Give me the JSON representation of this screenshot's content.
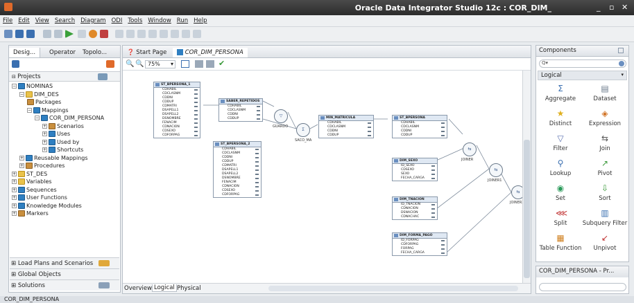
{
  "app": {
    "title": "Oracle Data Integrator Studio 12c : COR_DIM_",
    "minimize": "_",
    "maximize": "▫",
    "close": "✕"
  },
  "menu": [
    "File",
    "Edit",
    "View",
    "Search",
    "Diagram",
    "ODI",
    "Tools",
    "Window",
    "Run",
    "Help"
  ],
  "left": {
    "tabs": [
      "Desig...",
      "Operator",
      "Topolo..."
    ],
    "section": "Projects",
    "tree": [
      {
        "label": "NOMINAS",
        "depth": 0,
        "exp": "−",
        "icon": "project"
      },
      {
        "label": "DIM_DES",
        "depth": 1,
        "exp": "−",
        "icon": "folder"
      },
      {
        "label": "Packages",
        "depth": 2,
        "exp": "",
        "icon": "package"
      },
      {
        "label": "Mappings",
        "depth": 2,
        "exp": "−",
        "icon": "map"
      },
      {
        "label": "COR_DIM_PERSONA",
        "depth": 3,
        "exp": "−",
        "icon": "map"
      },
      {
        "label": "Scenarios",
        "depth": 4,
        "exp": "+",
        "icon": "scenario"
      },
      {
        "label": "Uses",
        "depth": 4,
        "exp": "+",
        "icon": "uses"
      },
      {
        "label": "Used by",
        "depth": 4,
        "exp": "+",
        "icon": "uses"
      },
      {
        "label": "Shortcuts",
        "depth": 4,
        "exp": "+",
        "icon": "uses"
      },
      {
        "label": "Reusable Mappings",
        "depth": 1,
        "exp": "+",
        "icon": "reusable"
      },
      {
        "label": "Procedures",
        "depth": 1,
        "exp": "+",
        "icon": "procedure"
      },
      {
        "label": "ST_DES",
        "depth": 0,
        "exp": "+",
        "icon": "folder"
      },
      {
        "label": "Variables",
        "depth": 0,
        "exp": "+",
        "icon": "variable"
      },
      {
        "label": "Sequences",
        "depth": 0,
        "exp": "+",
        "icon": "sequence"
      },
      {
        "label": "User Functions",
        "depth": 0,
        "exp": "+",
        "icon": "function"
      },
      {
        "label": "Knowledge Modules",
        "depth": 0,
        "exp": "+",
        "icon": "km"
      },
      {
        "label": "Markers",
        "depth": 0,
        "exp": "+",
        "icon": "marker"
      }
    ],
    "accordions": [
      "Load Plans and Scenarios",
      "Global Objects",
      "Solutions"
    ]
  },
  "editor": {
    "tabs": [
      "Start Page",
      "COR_DIM_PERSONA"
    ],
    "zoom": "75%",
    "bottom_tabs": [
      "Overview",
      "Logical",
      "Physical"
    ],
    "tables": {
      "st1": {
        "title": "ST_BPERSONA_1",
        "rows": [
          "CDHABIL",
          "CDCLASNM",
          "CDDNI",
          "CDDUP",
          "CDMATRI",
          "DSAPELL1",
          "DSAPELL2",
          "DSNOMBRE",
          "FENACIM",
          "CDNACION",
          "CDSEXO",
          "CDFORPAG"
        ]
      },
      "saber": {
        "title": "SABER_REPETIDOS",
        "rows": [
          "CDHABIL",
          "CDCLASNM",
          "CDDNI",
          "CDDUP"
        ]
      },
      "st2": {
        "title": "ST_BPERSONA_2",
        "rows": [
          "CDHABIL",
          "CDCLASNM",
          "CDDNI",
          "CDDUP",
          "CDMATRI",
          "DSAPELL1",
          "DSAPELL2",
          "DSNOMBRE",
          "FENACIM",
          "CDNACION",
          "CDSEXO",
          "CDFORPAG"
        ]
      },
      "min": {
        "title": "MIN_MATRICULA",
        "rows": [
          "CDHABIL",
          "CDCLASNM",
          "CDDNI",
          "CDDUP"
        ]
      },
      "stp": {
        "title": "ST_BPERSONA",
        "rows": [
          "CDHABIL",
          "CDCLASNM",
          "CDDNI",
          "CDDUP"
        ]
      },
      "sexo": {
        "title": "DIM_SEXO",
        "rows": [
          "ID_SEXO",
          "CDSEXO",
          "SEXO",
          "FECHA_CARGA"
        ]
      },
      "nac": {
        "title": "DIM_TNACION",
        "rows": [
          "ID_TNACION",
          "CDNACION",
          "DSNACION",
          "CDNACHAC"
        ]
      },
      "pago": {
        "title": "DIM_FORMA_PAGO",
        "rows": [
          "ID_FORPAG",
          "CDFORPAG",
          "FORPAG",
          "FECHA_CARGA"
        ]
      }
    },
    "nodes": {
      "guardo": "GUARDO",
      "saco": "SACO_MA",
      "joiner": "JOINER",
      "joiner1": "JOINER1",
      "joiner2": "JOINER2"
    }
  },
  "components": {
    "title": "Components",
    "category": "Logical",
    "items": [
      {
        "label": "Aggregate",
        "icon": "Σ",
        "color": "#3a6fb0"
      },
      {
        "label": "Dataset",
        "icon": "▤",
        "color": "#6a7a8a"
      },
      {
        "label": "Distinct",
        "icon": "★",
        "color": "#e0b020"
      },
      {
        "label": "Expression",
        "icon": "◈",
        "color": "#d07020"
      },
      {
        "label": "Filter",
        "icon": "▽",
        "color": "#5a70b0"
      },
      {
        "label": "Join",
        "icon": "⇆",
        "color": "#555"
      },
      {
        "label": "Lookup",
        "icon": "⚲",
        "color": "#3a6fb0"
      },
      {
        "label": "Pivot",
        "icon": "↗",
        "color": "#3a9a3a"
      },
      {
        "label": "Set",
        "icon": "◉",
        "color": "#2a9a5a"
      },
      {
        "label": "Sort",
        "icon": "⇩",
        "color": "#3a9a3a"
      },
      {
        "label": "Split",
        "icon": "⋘",
        "color": "#c03030"
      },
      {
        "label": "Subquery Filter",
        "icon": "▥",
        "color": "#3a6fb0"
      },
      {
        "label": "Table Function",
        "icon": "▦",
        "color": "#d08020"
      },
      {
        "label": "Unpivot",
        "icon": "↙",
        "color": "#c03030"
      }
    ],
    "properties_title": "COR_DIM_PERSONA - Pr..."
  },
  "status": "COR_DIM_PERSONA"
}
